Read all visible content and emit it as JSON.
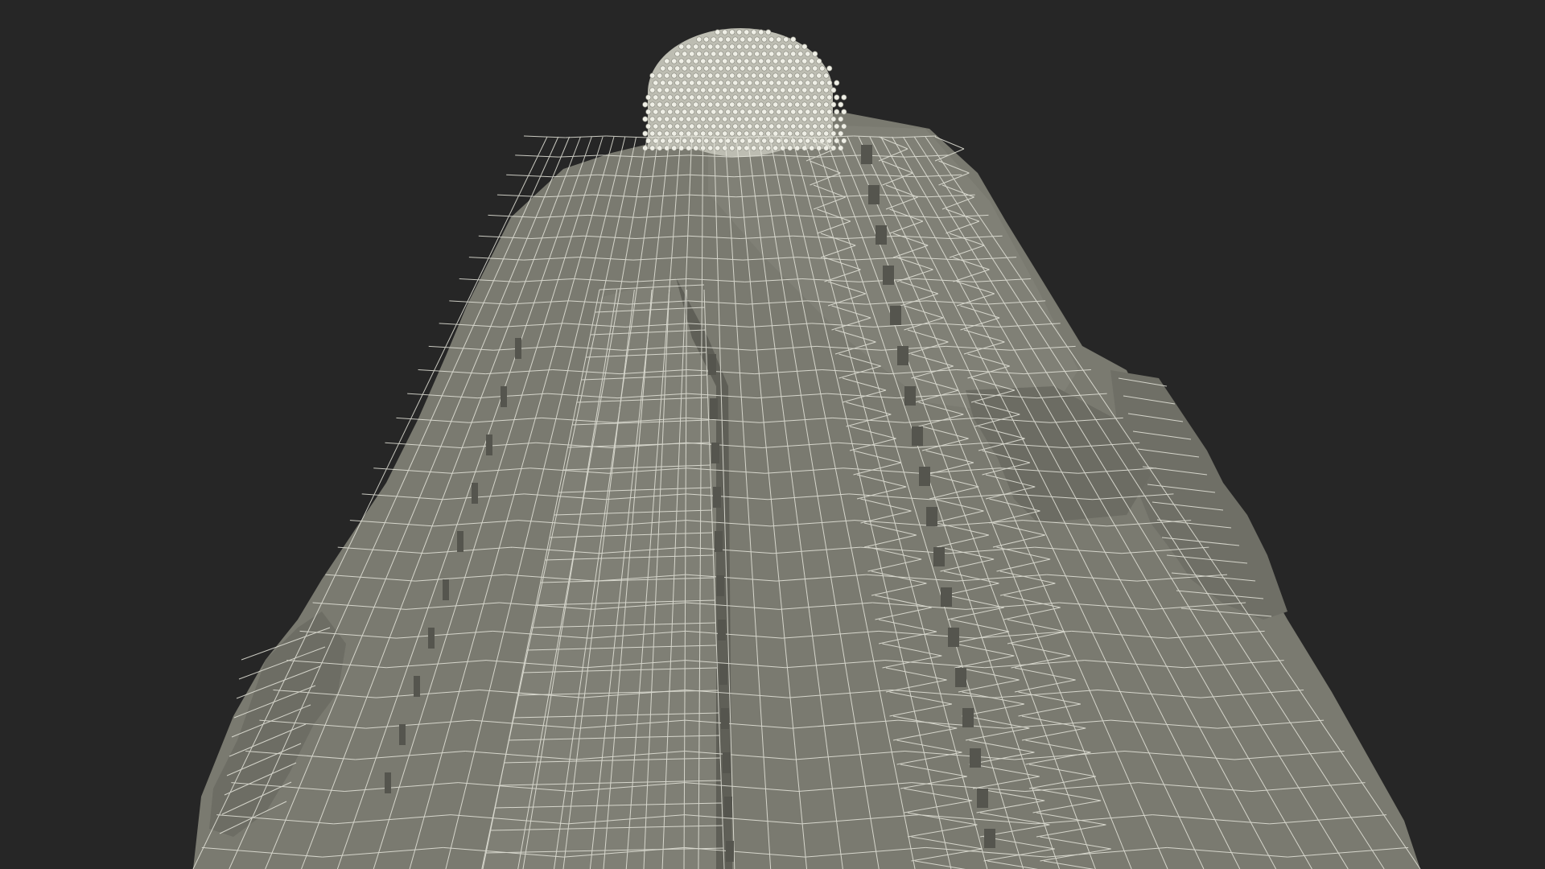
{
  "scene": {
    "subject": "wireframe-buddha-statue-low-angle",
    "colors": {
      "background": "#262626",
      "surface": "#7a7a70",
      "surface_shadow": "#62625a",
      "surface_light": "#86867c",
      "wire": "#e6e6dc",
      "head": "#bdbdb2",
      "head_dot": "#efefe6"
    }
  }
}
